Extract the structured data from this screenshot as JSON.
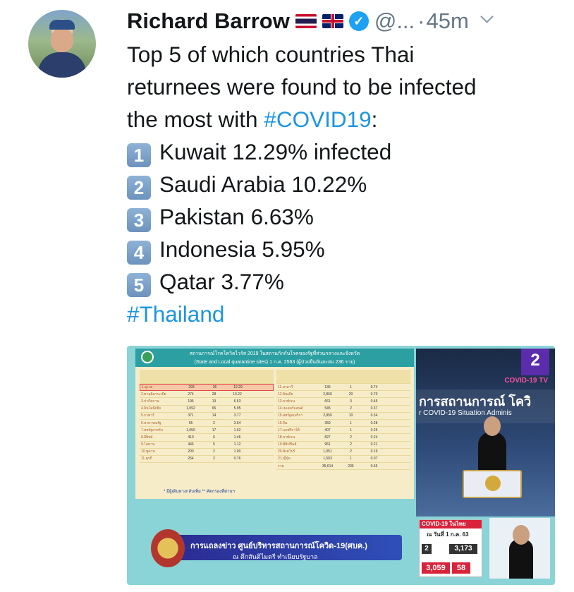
{
  "author": {
    "name": "Richard Barrow",
    "handle": "@...",
    "separator": "·",
    "time": "45m"
  },
  "icons": {
    "avatar": "profile-photo",
    "flag1": "thai-flag-icon",
    "flag2": "uk-flag-icon",
    "verified": "verified-badge-icon",
    "menu": "chevron-down-icon"
  },
  "tweet": {
    "intro_line1": "Top 5 of which countries Thai",
    "intro_line2": "returnees were found to be infected",
    "intro_line3_prefix": "the most with ",
    "intro_hashtag": "#COVID19",
    "intro_line3_suffix": ":",
    "list": [
      {
        "num": "1",
        "text": "Kuwait 12.29% infected"
      },
      {
        "num": "2",
        "text": "Saudi Arabia 10.22%"
      },
      {
        "num": "3",
        "text": "Pakistan 6.63%"
      },
      {
        "num": "4",
        "text": "Indonesia 5.95%"
      },
      {
        "num": "5",
        "text": "Qatar 3.77%"
      }
    ],
    "closing_hashtag": "#Thailand"
  },
  "media": {
    "slide_title": "สถานการณ์โรคโควิดไวรัส 2019 ในสถานกักกันโรคของรัฐที่ส่วนกลางและจังหวัด",
    "slide_subtitle": "(State and Local quarantine sites) 1 ก.ค. 2563 (ผู้ป่วยยืนยันสะสม 236 ราย)",
    "table_left": [
      [
        "1.คูเวต",
        "293",
        "36",
        "12.29"
      ],
      [
        "2.ซาอุดิอาระเบีย",
        "274",
        "28",
        "10.22"
      ],
      [
        "3.ปากีสถาน",
        "196",
        "13",
        "6.63"
      ],
      [
        "4.อินโดนีเซีย",
        "1,092",
        "65",
        "5.95"
      ],
      [
        "5.กาตาร์",
        "371",
        "14",
        "3.77"
      ],
      [
        "6.สาธารณรัฐ",
        "55",
        "2",
        "3.64"
      ],
      [
        "7.สหรัฐอาหรับ",
        "1,050",
        "17",
        "1.62"
      ],
      [
        "8.อียิปต์",
        "410",
        "6",
        "1.46"
      ],
      [
        "9.โอมาน",
        "446",
        "5",
        "1.12"
      ],
      [
        "10.ซูดาน",
        "200",
        "2",
        "1.00"
      ],
      [
        "11.ตุรกี",
        "264",
        "2",
        "0.76"
      ]
    ],
    "table_right": [
      [
        "11.มาลาวี",
        "135",
        "1",
        "0.74"
      ],
      [
        "12.อินเดีย",
        "2,860",
        "20",
        "0.70"
      ],
      [
        "13.บาห์เรน",
        "661",
        "3",
        "0.45"
      ],
      [
        "14.เนเธอร์แลนด์",
        "545",
        "2",
        "0.37"
      ],
      [
        "15.สหรัฐอเมริกา",
        "2,950",
        "10",
        "0.34"
      ],
      [
        "16.จีน",
        "359",
        "1",
        "0.28"
      ],
      [
        "17.แอฟริกาใต้",
        "407",
        "1",
        "0.25"
      ],
      [
        "18.บาห์เรน",
        "827",
        "2",
        "0.24"
      ],
      [
        "19.ฟิลิปปินส์",
        "961",
        "2",
        "0.21"
      ],
      [
        "20.สิงคโปร์",
        "1,051",
        "2",
        "0.19"
      ],
      [
        "21.ญี่ปุ่น",
        "1,503",
        "1",
        "0.07"
      ],
      [
        "รวม",
        "35,614",
        "236",
        "0.66"
      ]
    ],
    "note": "* มีผู้เดินทางกลับเพิ่ม   ** คัดกรองที่ด่านฯ",
    "channel": "2",
    "channel_label": "COVID-19 TV",
    "banner_thai": "การสถานการณ์ โควิ",
    "banner_eng": "r COVID-19 Situation Adminis",
    "bar_text1": "การแถลงข่าว ศูนย์บริหารสถานการณ์โควิด-19(ศบค.)",
    "bar_text2": "ณ ตึกสันติไมตรี ทำเนียบรัฐบาล",
    "stats_header": "COVID-19 ในไทย",
    "stats_date": "ณ วันที่ 1 ก.ค. 63",
    "stats_new": "2",
    "stats_total": "3,173",
    "stats_recovered": "3,059",
    "stats_deaths": "58"
  }
}
